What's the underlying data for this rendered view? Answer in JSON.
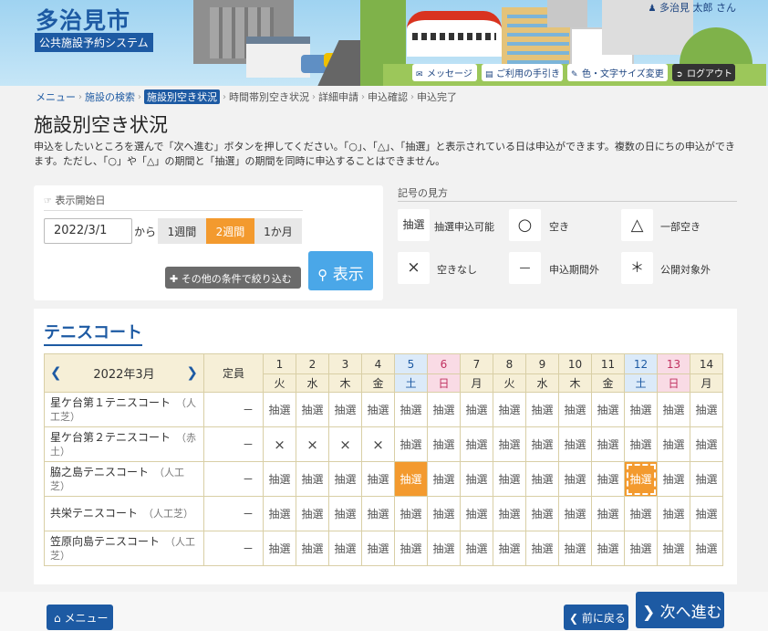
{
  "header": {
    "city": "多治見市",
    "system": "公共施設予約システム",
    "user": "多治見 太郎 さん",
    "buttons": [
      {
        "label": "メッセージ",
        "icon": "chat-icon"
      },
      {
        "label": "ご利用の手引き",
        "icon": "book-icon"
      },
      {
        "label": "色・文字サイズ変更",
        "icon": "brush-icon"
      },
      {
        "label": "ログアウト",
        "icon": "logout-icon"
      }
    ]
  },
  "breadcrumb": [
    "メニュー",
    "施設の検索",
    "施設別空き状況",
    "時間帯別空き状況",
    "詳細申請",
    "申込確認",
    "申込完了"
  ],
  "page": {
    "title": "施設別空き状況",
    "description": "申込をしたいところを選んで「次へ進む」ボタンを押してください。「○」、「△」、「抽選」と表示されている日は申込ができます。複数の日にちの申込ができます。ただし、「○」や「△」の期間と「抽選」の期間を同時に申込することはできません。"
  },
  "date_panel": {
    "label": "表示開始日",
    "date_value": "2022/3/1",
    "kara": "から",
    "periods": [
      "1週間",
      "2週間",
      "1か月"
    ],
    "selected_period": "2週間",
    "filter_button": "その他の条件で絞り込む",
    "show_button": "表示"
  },
  "legend": {
    "title": "記号の見方",
    "items": [
      {
        "symbol": "抽選",
        "label": "抽選申込可能"
      },
      {
        "symbol": "○",
        "label": "空き"
      },
      {
        "symbol": "△",
        "label": "一部空き"
      },
      {
        "symbol": "×",
        "label": "空きなし"
      },
      {
        "symbol": "—",
        "label": "申込期間外"
      },
      {
        "symbol": "＊",
        "label": "公開対象外"
      }
    ]
  },
  "facility": {
    "title": "テニスコート",
    "month": "2022年3月",
    "capacity_header": "定員",
    "days": [
      {
        "d": "1",
        "w": "火",
        "type": "weekday"
      },
      {
        "d": "2",
        "w": "水",
        "type": "weekday"
      },
      {
        "d": "3",
        "w": "木",
        "type": "weekday"
      },
      {
        "d": "4",
        "w": "金",
        "type": "weekday"
      },
      {
        "d": "5",
        "w": "土",
        "type": "sat"
      },
      {
        "d": "6",
        "w": "日",
        "type": "sun"
      },
      {
        "d": "7",
        "w": "月",
        "type": "weekday"
      },
      {
        "d": "8",
        "w": "火",
        "type": "weekday"
      },
      {
        "d": "9",
        "w": "水",
        "type": "weekday"
      },
      {
        "d": "10",
        "w": "木",
        "type": "weekday"
      },
      {
        "d": "11",
        "w": "金",
        "type": "weekday"
      },
      {
        "d": "12",
        "w": "土",
        "type": "sat"
      },
      {
        "d": "13",
        "w": "日",
        "type": "sun"
      },
      {
        "d": "14",
        "w": "月",
        "type": "weekday"
      }
    ],
    "rows": [
      {
        "name": "星ケ台第１テニスコート",
        "sub": "（人工芝）",
        "cap": "－",
        "cells": [
          "抽選",
          "抽選",
          "抽選",
          "抽選",
          "抽選",
          "抽選",
          "抽選",
          "抽選",
          "抽選",
          "抽選",
          "抽選",
          "抽選",
          "抽選",
          "抽選"
        ]
      },
      {
        "name": "星ケ台第２テニスコート",
        "sub": "（赤土）",
        "cap": "－",
        "cells": [
          "×",
          "×",
          "×",
          "×",
          "抽選",
          "抽選",
          "抽選",
          "抽選",
          "抽選",
          "抽選",
          "抽選",
          "抽選",
          "抽選",
          "抽選"
        ]
      },
      {
        "name": "脇之島テニスコート",
        "sub": "（人工芝）",
        "cap": "－",
        "cells": [
          "抽選",
          "抽選",
          "抽選",
          "抽選",
          "抽選",
          "抽選",
          "抽選",
          "抽選",
          "抽選",
          "抽選",
          "抽選",
          "抽選",
          "抽選",
          "抽選"
        ]
      },
      {
        "name": "共栄テニスコート",
        "sub": "（人工芝）",
        "cap": "－",
        "cells": [
          "抽選",
          "抽選",
          "抽選",
          "抽選",
          "抽選",
          "抽選",
          "抽選",
          "抽選",
          "抽選",
          "抽選",
          "抽選",
          "抽選",
          "抽選",
          "抽選"
        ]
      },
      {
        "name": "笠原向島テニスコート",
        "sub": "（人工芝）",
        "cap": "－",
        "cells": [
          "抽選",
          "抽選",
          "抽選",
          "抽選",
          "抽選",
          "抽選",
          "抽選",
          "抽選",
          "抽選",
          "抽選",
          "抽選",
          "抽選",
          "抽選",
          "抽選"
        ]
      }
    ],
    "selected": [
      {
        "row": 2,
        "col": 4
      },
      {
        "row": 2,
        "col": 11
      }
    ]
  },
  "footer": {
    "menu": "メニュー",
    "back": "前に戻る",
    "next": "次へ進む"
  },
  "colors": {
    "brand": "#1d5aa3",
    "accent": "#f39a2e",
    "show_button": "#4aa7e8"
  }
}
